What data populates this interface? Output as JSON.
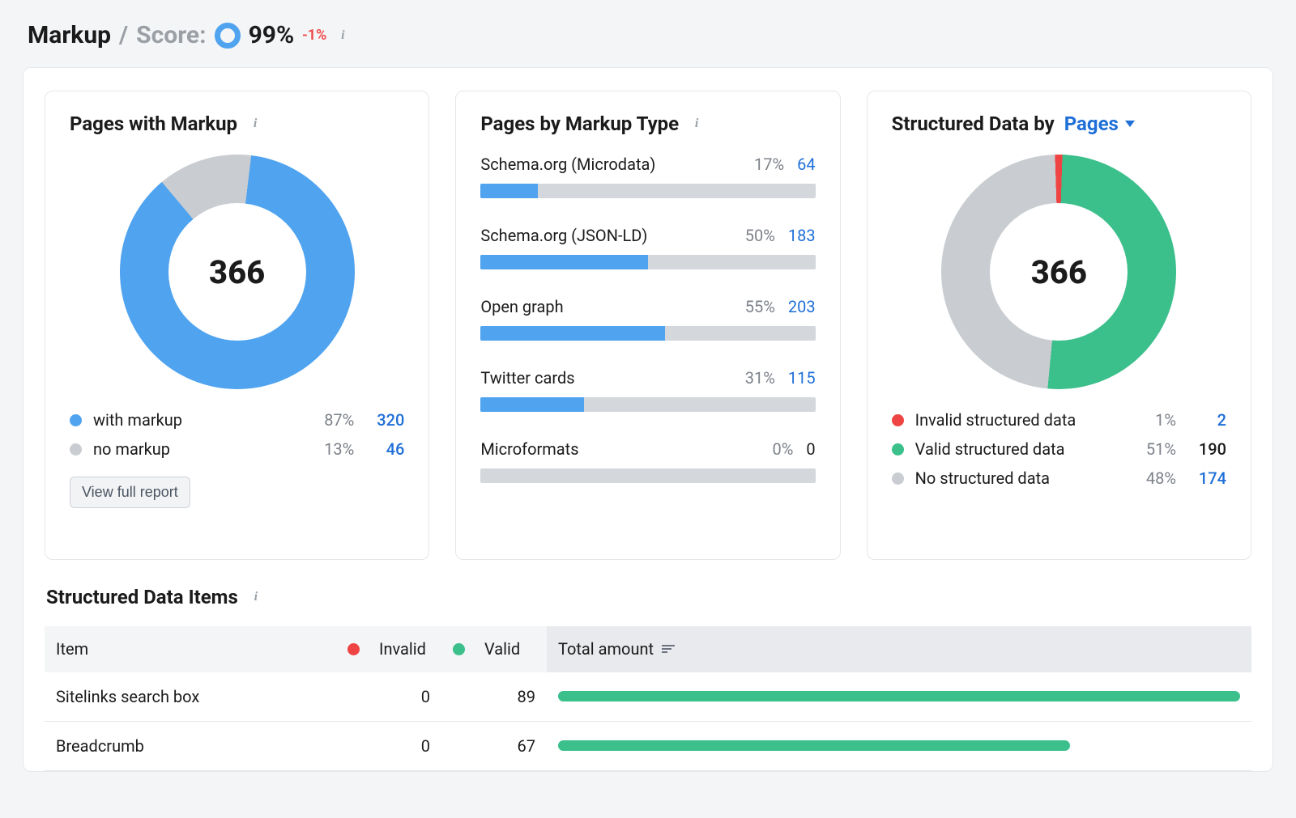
{
  "header": {
    "title": "Markup",
    "separator": "/",
    "score_label": "Score:",
    "score_value": "99%",
    "delta": "-1%"
  },
  "colors": {
    "blue": "#4fa3ef",
    "grey": "#c9ccd1",
    "green": "#3bbf8b",
    "red": "#ef4444",
    "link": "#1f6fd8"
  },
  "chart_data": [
    {
      "id": "pages_with_markup",
      "type": "pie",
      "title": "Pages with Markup",
      "center_label": "366",
      "series": [
        {
          "name": "with markup",
          "value": 320,
          "percent": 87,
          "color": "blue"
        },
        {
          "name": "no markup",
          "value": 46,
          "percent": 13,
          "color": "grey"
        }
      ]
    },
    {
      "id": "pages_by_markup_type",
      "type": "bar",
      "title": "Pages by Markup Type",
      "categories": [
        "Schema.org (Microdata)",
        "Schema.org (JSON-LD)",
        "Open graph",
        "Twitter cards",
        "Microformats"
      ],
      "percents": [
        17,
        50,
        55,
        31,
        0
      ],
      "values": [
        64,
        183,
        203,
        115,
        0
      ]
    },
    {
      "id": "structured_data_by_pages",
      "type": "pie",
      "title_prefix": "Structured Data by",
      "title_dropdown": "Pages",
      "center_label": "366",
      "series": [
        {
          "name": "Invalid structured data",
          "value": 2,
          "percent": 1,
          "color": "red",
          "link": true
        },
        {
          "name": "Valid structured data",
          "value": 190,
          "percent": 51,
          "color": "green",
          "link": false
        },
        {
          "name": "No structured data",
          "value": 174,
          "percent": 48,
          "color": "grey",
          "link": true
        }
      ]
    }
  ],
  "pages_with_markup": {
    "title": "Pages with Markup",
    "total": "366",
    "legend": [
      {
        "label": "with markup",
        "pct": "87%",
        "val": "320"
      },
      {
        "label": "no markup",
        "pct": "13%",
        "val": "46"
      }
    ],
    "button": "View full report"
  },
  "pages_by_type": {
    "title": "Pages by Markup Type",
    "rows": [
      {
        "label": "Schema.org (Microdata)",
        "pct": "17%",
        "val": "64"
      },
      {
        "label": "Schema.org (JSON-LD)",
        "pct": "50%",
        "val": "183"
      },
      {
        "label": "Open graph",
        "pct": "55%",
        "val": "203"
      },
      {
        "label": "Twitter cards",
        "pct": "31%",
        "val": "115"
      },
      {
        "label": "Microformats",
        "pct": "0%",
        "val": "0"
      }
    ]
  },
  "structured_by_pages": {
    "title_prefix": "Structured Data by",
    "dropdown": "Pages",
    "total": "366",
    "legend": [
      {
        "label": "Invalid structured data",
        "pct": "1%",
        "val": "2"
      },
      {
        "label": "Valid structured data",
        "pct": "51%",
        "val": "190"
      },
      {
        "label": "No structured data",
        "pct": "48%",
        "val": "174"
      }
    ]
  },
  "structured_items": {
    "title": "Structured Data Items",
    "columns": {
      "item": "Item",
      "invalid": "Invalid",
      "valid": "Valid",
      "total": "Total amount"
    },
    "max_total": 89,
    "rows": [
      {
        "item": "Sitelinks search box",
        "invalid": "0",
        "valid": "89",
        "total": 89
      },
      {
        "item": "Breadcrumb",
        "invalid": "0",
        "valid": "67",
        "total": 67
      }
    ]
  }
}
